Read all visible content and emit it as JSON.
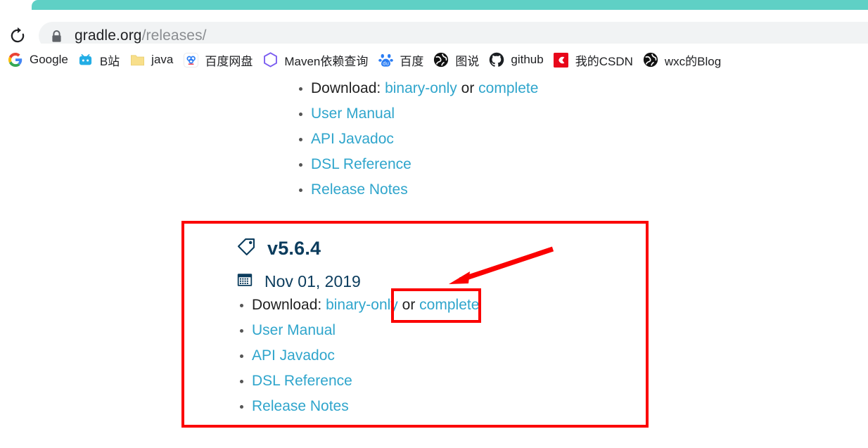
{
  "browser": {
    "tab_color": "#5fd0c5",
    "reload_icon": "reload-icon",
    "lock_icon": "lock-icon",
    "url_domain": "gradle.org",
    "url_path": "/releases/",
    "bookmarks": [
      {
        "icon": "google-icon",
        "label": "Google"
      },
      {
        "icon": "bilibili-icon",
        "label": "B站"
      },
      {
        "icon": "folder-icon",
        "label": "java"
      },
      {
        "icon": "baidu-pan-icon",
        "label": "百度网盘"
      },
      {
        "icon": "maven-icon",
        "label": "Maven依赖查询"
      },
      {
        "icon": "baidu-icon",
        "label": "百度"
      },
      {
        "icon": "globe-icon",
        "label": "图说"
      },
      {
        "icon": "github-icon",
        "label": "github"
      },
      {
        "icon": "csdn-icon",
        "label": "我的CSDN"
      },
      {
        "icon": "globe-icon",
        "label": "wxc的Blog"
      }
    ]
  },
  "page": {
    "link_color": "#2fa5cc",
    "heading_color": "#0b3c5d",
    "top_release": {
      "download_label": "Download:",
      "binary_link": "binary-only",
      "or_text": "or",
      "complete_link": "complete",
      "links": [
        "User Manual",
        "API Javadoc",
        "DSL Reference",
        "Release Notes"
      ]
    },
    "highlighted_release": {
      "tag_icon": "tag-icon",
      "version": "v5.6.4",
      "calendar_icon": "calendar-icon",
      "date": "Nov 01, 2019",
      "download_label": "Download:",
      "binary_link": "binary-only",
      "or_text": "or",
      "complete_link": "complete",
      "links": [
        "User Manual",
        "API Javadoc",
        "DSL Reference",
        "Release Notes"
      ]
    }
  },
  "annotations": {
    "color": "#fb0000",
    "outer_box": "release-block-highlight",
    "inner_box": "binary-only-highlight",
    "arrow": "pointer-arrow"
  }
}
